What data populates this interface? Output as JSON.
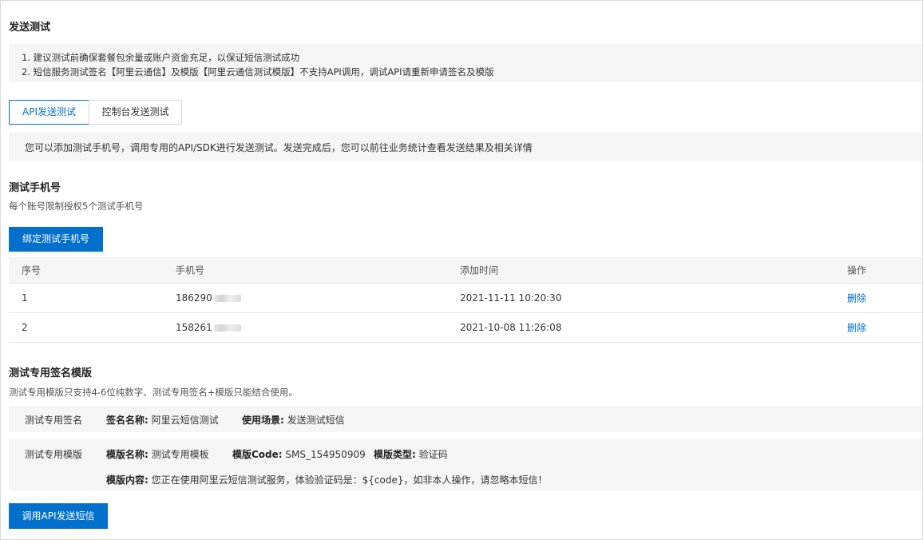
{
  "section": {
    "title": "发送测试"
  },
  "notice": {
    "line1": "1. 建议测试前确保套餐包余量或账户资金充足，以保证短信测试成功",
    "line2": "2. 短信服务测试签名【阿里云通信】及模版【阿里云通信测试模版】不支持API调用，调试API请重新申请签名及模版"
  },
  "tabs": [
    {
      "label": "API发送测试",
      "active": true
    },
    {
      "label": "控制台发送测试",
      "active": false
    }
  ],
  "info": {
    "text": "您可以添加测试手机号，调用专用的API/SDK进行发送测试。发送完成后，您可以前往业务统计查看发送结果及相关详情"
  },
  "phones": {
    "title": "测试手机号",
    "desc": "每个账号限制授权5个测试手机号",
    "bind_button": "绑定测试手机号",
    "columns": [
      "序号",
      "手机号",
      "添加时间",
      "操作"
    ],
    "rows": [
      {
        "index": "1",
        "phone": "186290",
        "time": "2021-11-11 10:20:30",
        "action": "删除"
      },
      {
        "index": "2",
        "phone": "158261",
        "time": "2021-10-08 11:26:08",
        "action": "删除"
      }
    ]
  },
  "template": {
    "title": "测试专用签名模版",
    "desc": "测试专用模版只支持4-6位纯数字、测试专用签名+模版只能结合使用。",
    "sign": {
      "label": "测试专用签名",
      "name_label": "签名名称:",
      "name_value": "阿里云短信测试",
      "scene_label": "使用场景:",
      "scene_value": "发送测试短信"
    },
    "tpl": {
      "label": "测试专用模版",
      "name_label": "模版名称:",
      "name_value": "测试专用模板",
      "code_label": "模版Code:",
      "code_value": "SMS_154950909",
      "type_label": "模版类型:",
      "type_value": "验证码",
      "content_label": "模版内容:",
      "content_value": "您正在使用阿里云短信测试服务，体验验证码是：${code}，如非本人操作，请忽略本短信！"
    },
    "send_button": "调用API发送短信"
  }
}
